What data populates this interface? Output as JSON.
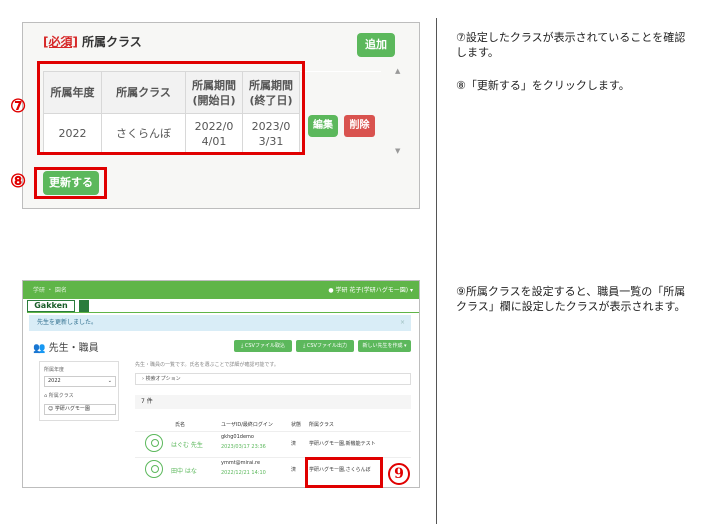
{
  "panel1": {
    "required_badge": "[必須]",
    "title": "所属クラス",
    "add_button": "追加",
    "table": {
      "headers": [
        "所属年度",
        "所属クラス",
        "所属期間\n(開始日)",
        "所属期間\n(終了日)"
      ],
      "rows": [
        [
          "2022",
          "さくらんぼ",
          "2022/0\n4/01",
          "2023/0\n3/31"
        ]
      ]
    },
    "edit_button": "編集",
    "delete_button": "削除",
    "update_button": "更新する"
  },
  "markers": {
    "m7": "⑦",
    "m8": "⑧",
    "m9": "9"
  },
  "notes": {
    "step7": "⑦設定したクラスが表示されていることを確認します。",
    "step8": "⑧「更新する」をクリックします。",
    "step9": "⑨所属クラスを設定すると、職員一覧の「所属クラス」欄に設定したクラスが表示されます。"
  },
  "panel2": {
    "topbar_crumb": "学研 ・ 園名",
    "topbar_user": "学研 花子(学研ハグモー園)",
    "brand": "Gakken",
    "alert": "先生を更新しました。",
    "page_title": "先生・職員",
    "actions": [
      "CSVファイル取込",
      "CSVファイル出力",
      "新しい先生を作成"
    ],
    "sidebar": {
      "year_label": "所属年度",
      "year_value": "2022",
      "class_label": "所属クラス",
      "class_value": "学研ハグモー園"
    },
    "description": "先生・職員の一覧です。氏名を選ぶことで詳細が確認可能です。",
    "search_options": "検索オプション",
    "count": "7 件",
    "columns": [
      "氏名",
      "ユーザID/最終ログイン",
      "状態",
      "所属クラス"
    ],
    "rows": [
      {
        "name": "はぐむ 先生",
        "login_id": "gkhg01demo",
        "last_login": "2023/03/17 23:36",
        "status": "済",
        "classes": "学研ハグモー園,新機能テスト"
      },
      {
        "name": "田中 はな",
        "login_id": "ymmt@mirai.re",
        "last_login": "2022/12/21 14:10",
        "status": "済",
        "classes": "学研ハグモー園,さくらんぼ"
      }
    ]
  }
}
